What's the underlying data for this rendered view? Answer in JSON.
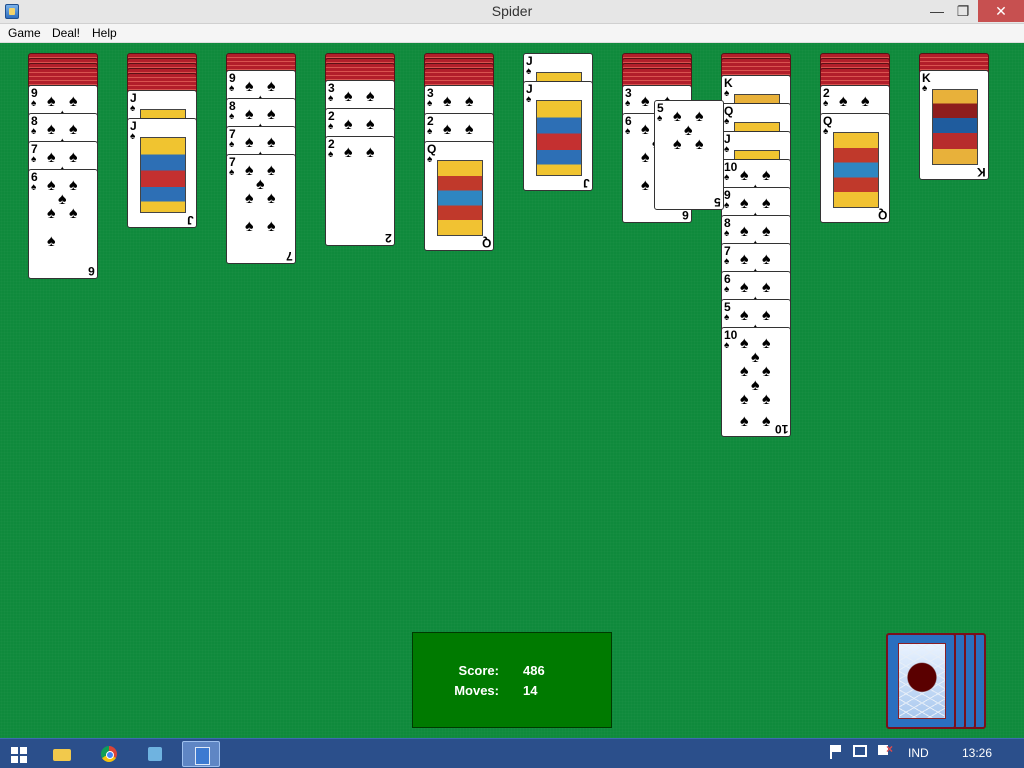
{
  "window": {
    "title": "Spider",
    "min_icon": "minimize-icon",
    "max_icon": "restore-icon",
    "close_icon": "close-icon"
  },
  "menu": {
    "game": "Game",
    "deal": "Deal!",
    "help": "Help"
  },
  "score": {
    "score_label": "Score:",
    "score_value": "486",
    "moves_label": "Moves:",
    "moves_value": "14"
  },
  "taskbar": {
    "lang": "IND",
    "time": "13:26"
  },
  "tableau": [
    {
      "down": 4,
      "up": [
        "9",
        "8",
        "7",
        "6"
      ]
    },
    {
      "down": 5,
      "up": [
        "J",
        "J"
      ]
    },
    {
      "down": 1,
      "up": [
        "9",
        "8",
        "7",
        "7"
      ]
    },
    {
      "down": 3,
      "up": [
        "3",
        "2",
        "2"
      ]
    },
    {
      "down": 4,
      "up": [
        "3",
        "2",
        "Q"
      ]
    },
    {
      "down": 0,
      "up": [
        "J",
        "J"
      ]
    },
    {
      "down": 4,
      "up": [
        "3",
        "6"
      ]
    },
    {
      "down": 2,
      "up": [
        "K",
        "Q",
        "J",
        "10",
        "9",
        "8",
        "7",
        "6",
        "5",
        "10"
      ]
    },
    {
      "down": 4,
      "up": [
        "2",
        "Q"
      ]
    },
    {
      "down": 1,
      "up": [
        "K"
      ]
    }
  ],
  "dragging_card": "5",
  "stock_count": 4,
  "suit": "♠"
}
